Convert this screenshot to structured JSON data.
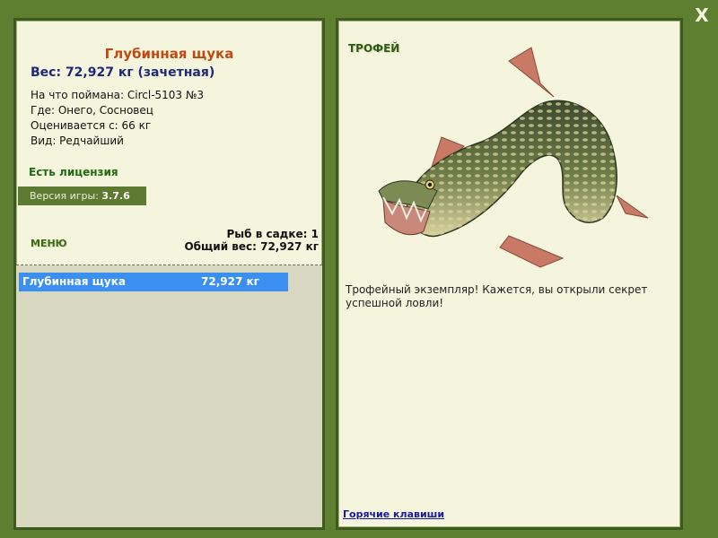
{
  "window": {
    "close_label": "X"
  },
  "fish": {
    "name": "Глубинная щука",
    "weight_line": "Вес: 72,927 кг (зачетная)",
    "bait_line": "На что поймана: Circl-5103 №3",
    "place_line": "Где: Онего, Сосновец",
    "value_line": "Оценивается с: 66 кг",
    "kind_line": "Вид: Редчайший"
  },
  "license": "Есть лицензия",
  "version": {
    "label": "Версия игры:",
    "value": "3.7.6"
  },
  "menu_label": "МЕНЮ",
  "keepnet": {
    "count_line": "Рыб в садке: 1",
    "total_line": "Общий вес: 72,927 кг",
    "items": [
      {
        "name": "Глубинная щука",
        "weight": "72,927 кг"
      }
    ]
  },
  "trophy": {
    "label": "ТРОФЕЙ",
    "description": "Трофейный экземпляр! Кажется, вы открыли секрет успешной ловли!",
    "image_icon": "pike-fish-illustration"
  },
  "hotkeys_label": "Горячие клавиши",
  "colors": {
    "frame": "#5f7f30",
    "panel": "#f5f4dc",
    "title": "#c04a10",
    "weight": "#1d2a7a",
    "selection": "#3a8ff0",
    "license": "#1f6a12"
  }
}
